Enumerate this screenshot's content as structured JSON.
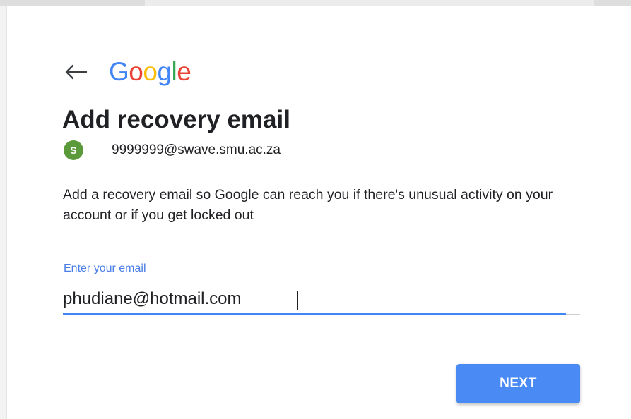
{
  "logo": {
    "letters": [
      "G",
      "o",
      "o",
      "g",
      "l",
      "e"
    ],
    "colors": [
      "#4285F4",
      "#EA4335",
      "#FBBC05",
      "#4285F4",
      "#34A853",
      "#EA4335"
    ]
  },
  "header": {
    "back_icon": "arrow-left-icon",
    "title": "Add recovery email"
  },
  "account": {
    "avatar_letter": "S",
    "avatar_color": "#5b9a3a",
    "email": "9999999@swave.smu.ac.za"
  },
  "description": "Add a recovery email so Google can reach you if there's unusual activity on your account or if you get locked out",
  "form": {
    "label": "Enter your email",
    "value": "phudiane@hotmail.com",
    "accent": "#4285F4"
  },
  "actions": {
    "next_label": "NEXT",
    "next_color": "#4a8af4"
  }
}
